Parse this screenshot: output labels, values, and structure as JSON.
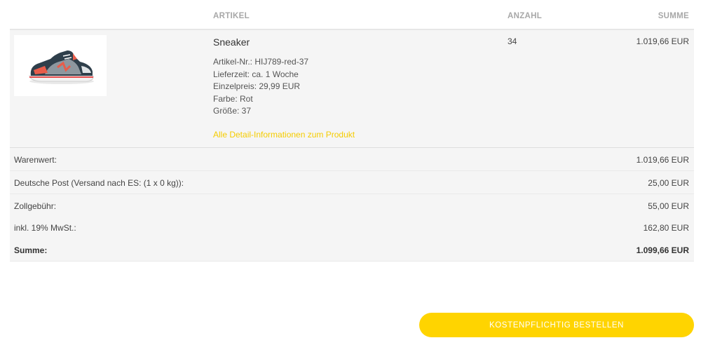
{
  "cart": {
    "headers": {
      "artikel": "ARTIKEL",
      "anzahl": "ANZAHL",
      "summe": "SUMME"
    },
    "item": {
      "image_icon": "sneaker-image",
      "name": "Sneaker",
      "details": [
        "Artikel-Nr.: HIJ789-red-37",
        "Lieferzeit: ca. 1 Woche",
        "Einzelpreis: 29,99 EUR",
        "Farbe: Rot",
        "Größe: 37"
      ],
      "detail_link": "Alle Detail-Informationen zum Produkt",
      "quantity": "34",
      "line_total": "1.019,66 EUR"
    },
    "summary": [
      {
        "label": "Warenwert:",
        "value": "1.019,66 EUR"
      },
      {
        "label": "Deutsche Post (Versand nach ES: (1 x 0 kg)):",
        "value": "25,00 EUR"
      },
      {
        "label": "Zollgebühr:",
        "value": "55,00 EUR"
      },
      {
        "label": "inkl. 19% MwSt.:",
        "value": "162,80 EUR"
      },
      {
        "label": "Summe:",
        "value": "1.099,66 EUR"
      }
    ],
    "order_button": "KOSTENPFLICHTIG BESTELLEN"
  },
  "colors": {
    "accent": "#ffd400",
    "link": "#f5cc00",
    "row_bg": "#f5f5f5"
  }
}
